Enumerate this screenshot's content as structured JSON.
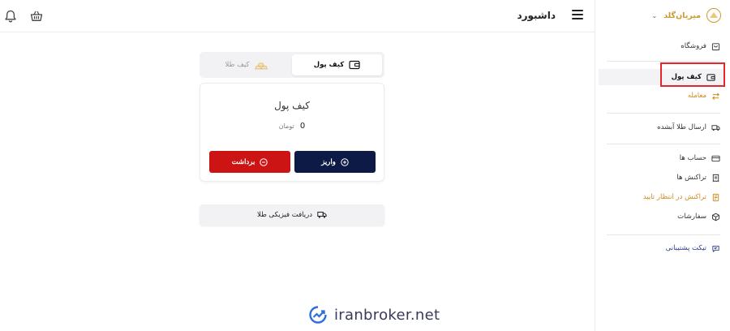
{
  "header": {
    "page_title": "داشبورد"
  },
  "brand": {
    "name": "میریان‌گلد"
  },
  "sidebar": {
    "items": [
      {
        "label": "فروشگاه",
        "icon": "store-icon"
      },
      {
        "label": "کیف پول",
        "icon": "wallet-icon",
        "active": true
      },
      {
        "label": "معامله",
        "icon": "swap-icon",
        "color": "#d08a1c"
      },
      {
        "label": "ارسال طلا آبشده",
        "icon": "truck-icon"
      },
      {
        "label": "حساب ها",
        "icon": "card-icon"
      },
      {
        "label": "تراکنش ها",
        "icon": "receipt-icon"
      },
      {
        "label": "تراکنش در انتظار تایید",
        "icon": "document-icon",
        "color": "#d08a1c"
      },
      {
        "label": "سفارشات",
        "icon": "box-icon"
      },
      {
        "label": "تیکت پشتیبانی",
        "icon": "chat-icon",
        "color": "#2c3e8c"
      }
    ]
  },
  "wallet": {
    "tabs": [
      {
        "label": "کیف پول",
        "icon": "wallet-icon",
        "active": true
      },
      {
        "label": "کیف طلا",
        "icon": "gold-bars-icon",
        "active": false
      }
    ],
    "card_title": "کیف پول",
    "balance": "0",
    "currency": "تومان",
    "deposit_label": "واریز",
    "withdraw_label": "برداشت"
  },
  "physical": {
    "label": "دریافت فیزیکی طلا"
  },
  "watermark": {
    "text": "iranbroker.net"
  },
  "colors": {
    "accent_gold": "#c99a2e",
    "deposit": "#0c1a45",
    "withdraw": "#cc1414",
    "highlight": "#e5262b"
  }
}
